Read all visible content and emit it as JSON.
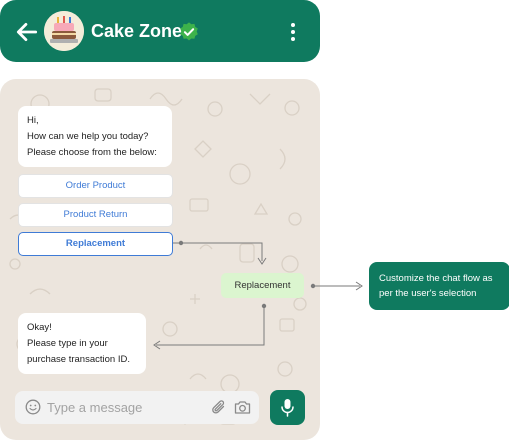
{
  "header": {
    "title": "Cake Zone",
    "back_icon": "arrow-left-icon",
    "avatar_icon": "cake-icon",
    "verified_icon": "verified-badge-icon",
    "menu_icon": "more-vertical-icon"
  },
  "chat": {
    "greeting_lines": [
      "Hi,",
      "How can we help you today?",
      "Please choose from the below:"
    ],
    "options": [
      "Order Product",
      "Product Return",
      "Replacement"
    ],
    "selected_option": "Replacement",
    "user_reply": "Replacement",
    "bot_reply_lines": [
      "Okay!",
      "Please type in your",
      "purchase transaction ID."
    ]
  },
  "composer": {
    "placeholder": "Type a message",
    "emoji_icon": "emoji-icon",
    "attach_icon": "paperclip-icon",
    "camera_icon": "camera-icon",
    "mic_icon": "microphone-icon"
  },
  "callout": {
    "lines": [
      "Customize the chat flow as",
      "per the user's selection"
    ]
  },
  "colors": {
    "brand_green": "#0f7a5f",
    "chat_background": "#ece5dd",
    "link_blue": "#3f7bd6",
    "reply_green": "#dbf5cf",
    "verified_green": "#3db24b"
  }
}
